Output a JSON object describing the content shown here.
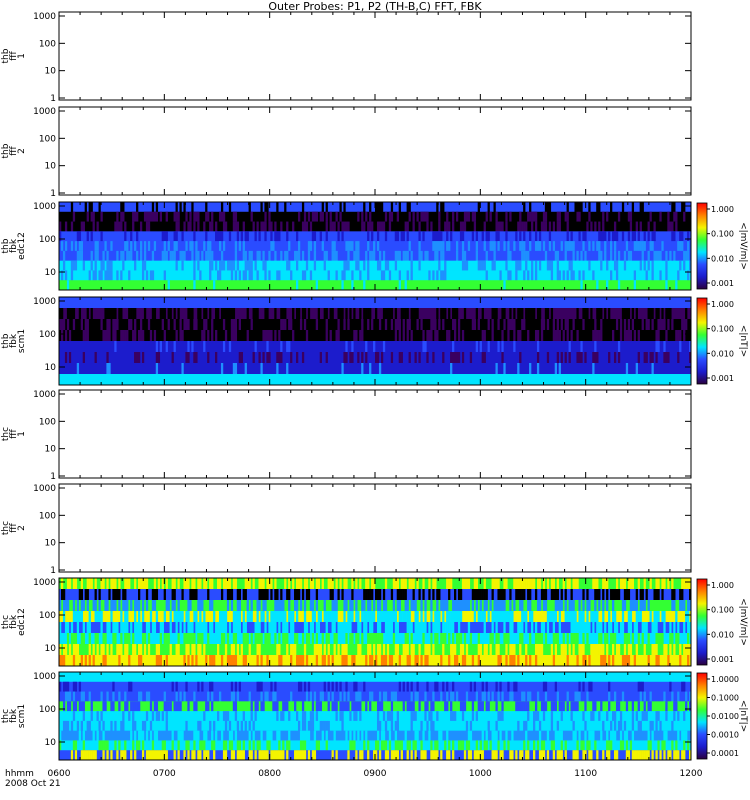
{
  "title": "Outer Probes: P1, P2 (TH-B,C) FFT, FBK",
  "x_axis": {
    "label_line1": "hhmm",
    "label_line2": "2008 Oct 21",
    "ticks": [
      "0600",
      "0700",
      "0800",
      "0900",
      "1000",
      "1100",
      "1200"
    ]
  },
  "colorbar_tick_sets": {
    "edc": [
      "1.000",
      "0.100",
      "0.010",
      "0.001"
    ],
    "scm_b": [
      "1.000",
      "0.100",
      "0.010",
      "0.001"
    ],
    "scm_c": [
      "1.0000",
      "0.1000",
      "0.0100",
      "0.0010",
      "0.0001"
    ]
  },
  "colors": {
    "black": "#000000",
    "purple": "#3a0060",
    "darkblue": "#1c1ccc",
    "blue": "#2a4cff",
    "lightblue": "#1e90ff",
    "cyan": "#00e5ff",
    "green": "#33ff33",
    "yellow": "#f4f400",
    "orange": "#ff8000",
    "red": "#ff0000"
  },
  "chart_data": [
    {
      "type": "heatmap",
      "panel": "thb-fff-1",
      "ylabel": [
        "thb",
        "fff",
        "1"
      ],
      "y_ticks": [
        "1",
        "10",
        "100",
        "1000"
      ],
      "ylim": [
        1,
        1000
      ],
      "empty": true
    },
    {
      "type": "heatmap",
      "panel": "thb-fff-2",
      "ylabel": [
        "thb",
        "fff",
        "2"
      ],
      "y_ticks": [
        "1",
        "10",
        "100",
        "1000"
      ],
      "ylim": [
        1,
        1000
      ],
      "empty": true
    },
    {
      "type": "heatmap",
      "panel": "thb-fbk-edc12",
      "ylabel": [
        "thb",
        "fbk",
        "edc12"
      ],
      "y_ticks": [
        "10",
        "100",
        "1000"
      ],
      "colorbar_label": "<|mV/m|>",
      "colorbar_ticks": "edc",
      "bands": [
        {
          "color": "blue",
          "alt": "black",
          "noise": 0.25
        },
        {
          "color": "black",
          "alt": "purple",
          "noise": 0.35
        },
        {
          "color": "black",
          "alt": "purple",
          "noise": 0.35
        },
        {
          "color": "blue",
          "alt": "darkblue",
          "noise": 0.3
        },
        {
          "color": "blue",
          "alt": "lightblue",
          "noise": 0.35
        },
        {
          "color": "blue",
          "alt": "lightblue",
          "noise": 0.4
        },
        {
          "color": "cyan",
          "alt": "lightblue",
          "noise": 0.3
        },
        {
          "color": "cyan",
          "alt": "lightblue",
          "noise": 0.3
        },
        {
          "color": "green",
          "alt": "cyan",
          "noise": 0.05
        }
      ]
    },
    {
      "type": "heatmap",
      "panel": "thb-fbk-scm1",
      "ylabel": [
        "thb",
        "fbk",
        "scm1"
      ],
      "y_ticks": [
        "10",
        "100",
        "1000"
      ],
      "colorbar_label": "<|nT|>",
      "colorbar_ticks": "scm_b",
      "bands": [
        {
          "color": "blue",
          "alt": "blue",
          "noise": 0.0
        },
        {
          "color": "purple",
          "alt": "black",
          "noise": 0.5
        },
        {
          "color": "black",
          "alt": "purple",
          "noise": 0.35
        },
        {
          "color": "black",
          "alt": "purple",
          "noise": 0.3
        },
        {
          "color": "darkblue",
          "alt": "blue",
          "noise": 0.1
        },
        {
          "color": "darkblue",
          "alt": "purple",
          "noise": 0.3
        },
        {
          "color": "darkblue",
          "alt": "lightblue",
          "noise": 0.08
        },
        {
          "color": "cyan",
          "alt": "cyan",
          "noise": 0.0
        }
      ]
    },
    {
      "type": "heatmap",
      "panel": "thc-fff-1",
      "ylabel": [
        "thc",
        "fff",
        "1"
      ],
      "y_ticks": [
        "1",
        "10",
        "100",
        "1000"
      ],
      "ylim": [
        1,
        1000
      ],
      "empty": true
    },
    {
      "type": "heatmap",
      "panel": "thc-fff-2",
      "ylabel": [
        "thc",
        "fff",
        "2"
      ],
      "y_ticks": [
        "1",
        "10",
        "100",
        "1000"
      ],
      "ylim": [
        1,
        1000
      ],
      "empty": true
    },
    {
      "type": "heatmap",
      "panel": "thc-fbk-edc12",
      "ylabel": [
        "thc",
        "fbk",
        "edc12"
      ],
      "y_ticks": [
        "10",
        "100",
        "1000"
      ],
      "colorbar_label": "<|mV/m|>",
      "colorbar_ticks": "edc",
      "bands": [
        {
          "color": "green",
          "alt": "yellow",
          "noise": 0.5
        },
        {
          "color": "blue",
          "alt": "black",
          "noise": 0.45
        },
        {
          "color": "green",
          "alt": "lightblue",
          "noise": 0.5
        },
        {
          "color": "yellow",
          "alt": "cyan",
          "noise": 0.55
        },
        {
          "color": "blue",
          "alt": "cyan",
          "noise": 0.5
        },
        {
          "color": "cyan",
          "alt": "green",
          "noise": 0.45
        },
        {
          "color": "green",
          "alt": "yellow",
          "noise": 0.5
        },
        {
          "color": "yellow",
          "alt": "orange",
          "noise": 0.35
        }
      ]
    },
    {
      "type": "heatmap",
      "panel": "thc-fbk-scm1",
      "ylabel": [
        "thc",
        "fbk",
        "scm1"
      ],
      "y_ticks": [
        "10",
        "100",
        "1000"
      ],
      "colorbar_label": "<|nT|>",
      "colorbar_ticks": "scm_c",
      "bands": [
        {
          "color": "cyan",
          "alt": "cyan",
          "noise": 0.0
        },
        {
          "color": "blue",
          "alt": "darkblue",
          "noise": 0.2
        },
        {
          "color": "blue",
          "alt": "lightblue",
          "noise": 0.3
        },
        {
          "color": "green",
          "alt": "blue",
          "noise": 0.45
        },
        {
          "color": "cyan",
          "alt": "lightblue",
          "noise": 0.3
        },
        {
          "color": "cyan",
          "alt": "lightblue",
          "noise": 0.25
        },
        {
          "color": "lightblue",
          "alt": "cyan",
          "noise": 0.3
        },
        {
          "color": "cyan",
          "alt": "green",
          "noise": 0.4
        },
        {
          "color": "blue",
          "alt": "yellow",
          "noise": 0.5
        }
      ]
    }
  ]
}
